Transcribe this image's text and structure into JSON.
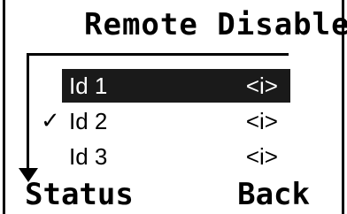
{
  "screen": {
    "title": "Remote Disable"
  },
  "list": {
    "items": [
      {
        "label": "Id 1",
        "suffix": "<i>",
        "selected": true,
        "checked": false
      },
      {
        "label": "Id 2",
        "suffix": "<i>",
        "selected": false,
        "checked": true
      },
      {
        "label": "Id 3",
        "suffix": "<i>",
        "selected": false,
        "checked": false
      }
    ],
    "check_mark": "✓"
  },
  "softkeys": {
    "left_label": "Status",
    "right_label": "Back"
  },
  "colors": {
    "background": "#ffffff",
    "foreground": "#000000",
    "selection": "#1a1a1a",
    "selection_text": "#ffffff"
  }
}
